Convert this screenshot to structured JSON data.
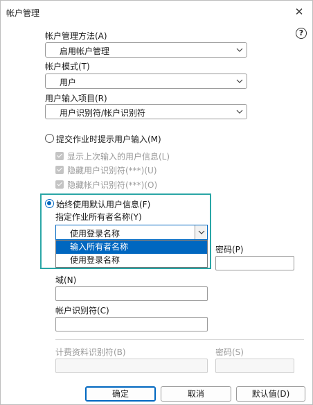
{
  "window": {
    "title": "帐户管理",
    "close_glyph": "✕",
    "help_glyph": "?"
  },
  "method": {
    "label": "帐户管理方法(A)",
    "value": "启用帐户管理"
  },
  "mode": {
    "label": "帐户模式(T)",
    "value": "用户"
  },
  "input_item": {
    "label": "用户输入项目(R)",
    "value": "用户识别符/帐户识别符"
  },
  "prompt_option": {
    "label": "提交作业时提示用户输入(M)",
    "selected": false,
    "sub_options": [
      {
        "label": "显示上次输入的用户信息(L)",
        "checked": true
      },
      {
        "label": "隐藏用户识别符(***)(U)",
        "checked": true
      },
      {
        "label": "隐藏帐户识别符(***)(O)",
        "checked": true
      }
    ]
  },
  "default_option": {
    "label": "始终使用默认用户信息(F)",
    "selected": true,
    "owner_label": "指定作业所有者名称(Y)",
    "owner_value": "使用登录名称",
    "owner_options": [
      {
        "label": "输入所有者名称",
        "highlighted": true
      },
      {
        "label": "使用登录名称",
        "highlighted": false
      }
    ]
  },
  "fields": {
    "password_label": "密码(P)",
    "domain_label": "域(N)",
    "account_id_label": "帐户识别符(C)",
    "billing_id_label": "计费资料识别符(B)",
    "billing_password_label": "密码(S)"
  },
  "buttons": {
    "ok": "确定",
    "cancel": "取消",
    "default": "默认值(D)"
  },
  "colors": {
    "accent": "#0067c0",
    "highlight_frame": "#2aa6a6",
    "disabled_text": "#9a9a9a"
  }
}
